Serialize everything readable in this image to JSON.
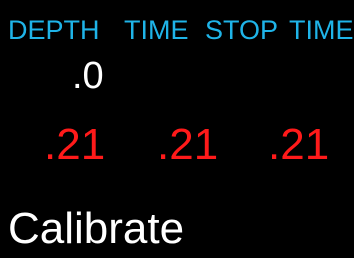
{
  "colors": {
    "background": "#000000",
    "header": "#1fb4e8",
    "value": "#ffffff",
    "reading": "#ff1a1a",
    "label": "#ffffff"
  },
  "header": {
    "depth": "DEPTH",
    "time1": "TIME",
    "stop": "STOP",
    "time2": "TIME"
  },
  "depth_value": ".0",
  "readings": [
    ".21",
    ".21",
    ".21"
  ],
  "status": {
    "label": "Calibrate"
  }
}
